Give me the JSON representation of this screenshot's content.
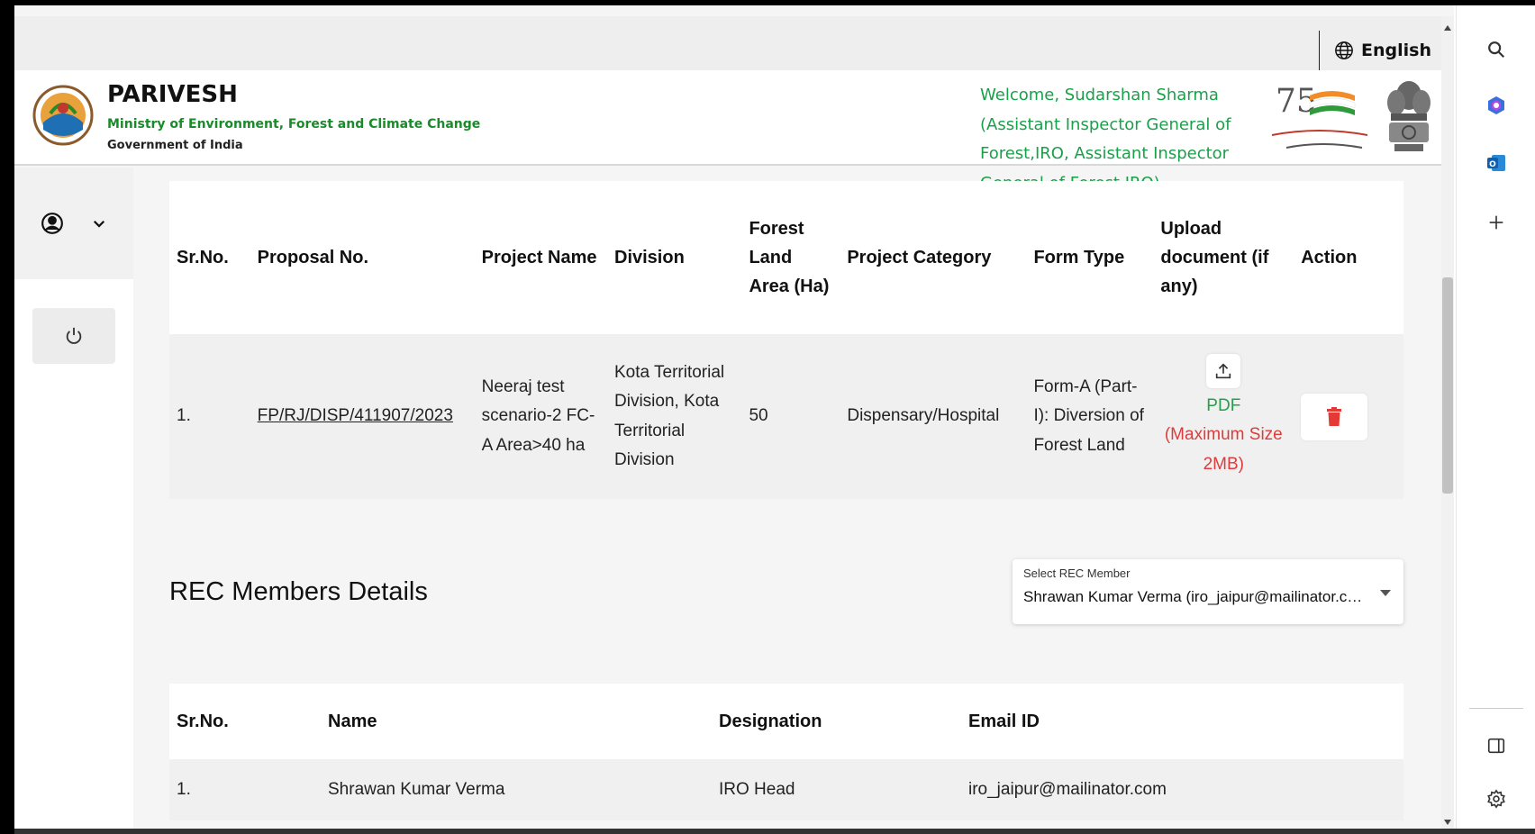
{
  "topbar": {
    "language": "English"
  },
  "header": {
    "brand_title": "PARIVESH",
    "ministry": "Ministry of Environment, Forest and Climate Change",
    "government": "Government of India",
    "welcome": "Welcome, Sudarshan Sharma (Assistant Inspector General of Forest,IRO, Assistant Inspector General of Forest,IRO)"
  },
  "proposal_table": {
    "headers": {
      "sr": "Sr.No.",
      "proposal": "Proposal No.",
      "project_name": "Project Name",
      "division": "Division",
      "forest_area": "Forest Land Area (Ha)",
      "category": "Project Category",
      "form_type": "Form Type",
      "upload": "Upload document (if any)",
      "action": "Action"
    },
    "rows": [
      {
        "sr": "1.",
        "proposal": "FP/RJ/DISP/411907/2023",
        "project_name": "Neeraj test scenario-2 FC-A Area>40 ha",
        "division": "Kota Territorial Division, Kota Territorial Division",
        "forest_area": "50",
        "category": "Dispensary/Hospital",
        "form_type": "Form-A (Part-I): Diversion of Forest Land",
        "upload_label": "PDF",
        "upload_limit": "(Maximum Size 2MB)"
      }
    ]
  },
  "rec": {
    "title": "REC Members Details",
    "select_label": "Select REC Member",
    "select_value": "Shrawan Kumar Verma (iro_jaipur@mailinator.com)"
  },
  "members_table": {
    "headers": {
      "sr": "Sr.No.",
      "name": "Name",
      "designation": "Designation",
      "email": "Email ID"
    },
    "rows": [
      {
        "sr": "1.",
        "name": "Shrawan Kumar Verma",
        "designation": "IRO Head",
        "email": "iro_jaipur@mailinator.com"
      }
    ]
  },
  "colors": {
    "green": "#1aa04a",
    "red": "#e03b3b",
    "accent_blue": "#2b5cc9"
  },
  "icons": [
    "globe-icon",
    "user-circle-icon",
    "chevron-down-icon",
    "power-icon",
    "upload-icon",
    "trash-icon",
    "search-icon",
    "copilot-icon",
    "outlook-icon",
    "plus-icon",
    "sidebar-toggle-icon",
    "settings-icon"
  ]
}
